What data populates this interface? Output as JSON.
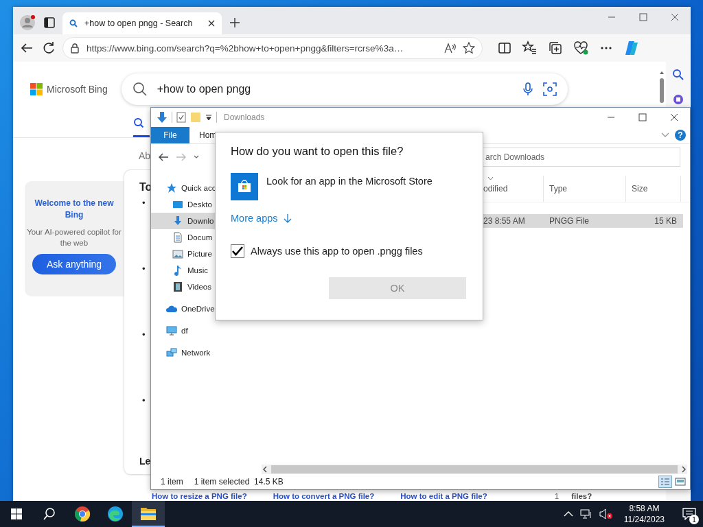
{
  "browser": {
    "tab_title": "+how to open pngg - Search",
    "url": "https://www.bing.com/search?q=%2bhow+to+open+pngg&filters=rcrse%3a…"
  },
  "bing": {
    "brand": "Microsoft Bing",
    "query": "+how to open pngg",
    "answer_label": "Ab",
    "welcome": {
      "title": "Welcome to the new Bing",
      "subtitle": "Your AI-powered copilot for the web",
      "button": "Ask anything"
    },
    "card_heading": "To",
    "bullets": [
      "•",
      "•",
      "•",
      "•"
    ],
    "footer_heading": "Le",
    "related": [
      "How to resize a PNG file?",
      "How to convert a PNG file?",
      "How to edit a PNG file?"
    ],
    "related_count": "1",
    "related_tail": "files?"
  },
  "explorer": {
    "title": "Downloads",
    "ribbon_tabs": [
      {
        "label": "File",
        "selected": true
      },
      {
        "label": "Hom",
        "selected": false
      }
    ],
    "help": "?",
    "search_placeholder": "arch Downloads",
    "nav": [
      {
        "label": "Quick acc",
        "selected": false,
        "children": [
          {
            "label": "Deskto",
            "selected": false
          },
          {
            "label": "Downlo",
            "selected": true
          },
          {
            "label": "Docum",
            "selected": false
          },
          {
            "label": "Picture",
            "selected": false
          },
          {
            "label": "Music",
            "selected": false
          },
          {
            "label": "Videos",
            "selected": false
          }
        ]
      },
      {
        "label": "OneDrive",
        "selected": false
      },
      {
        "label": "df",
        "selected": false
      },
      {
        "label": "Network",
        "selected": false
      }
    ],
    "columns": [
      "odified",
      "Type",
      "Size"
    ],
    "rows": [
      {
        "cells": [
          "23 8:55 AM",
          "PNGG File",
          "15 KB"
        ],
        "selected": true
      }
    ],
    "status": {
      "count": "1 item",
      "selection": "1 item selected",
      "size": "14.5 KB"
    }
  },
  "dialog": {
    "title": "How do you want to open this file?",
    "option": "Look for an app in the Microsoft Store",
    "more": "More apps",
    "always": {
      "label": "Always use this app to open .pngg files",
      "checked": true
    },
    "ok": {
      "label": "OK",
      "disabled": true
    }
  },
  "taskbar": {
    "apps": [
      {
        "selected": false
      },
      {
        "selected": false
      },
      {
        "selected": true
      }
    ],
    "time": "8:58 AM",
    "date": "11/24/2023",
    "notifications": "1"
  }
}
